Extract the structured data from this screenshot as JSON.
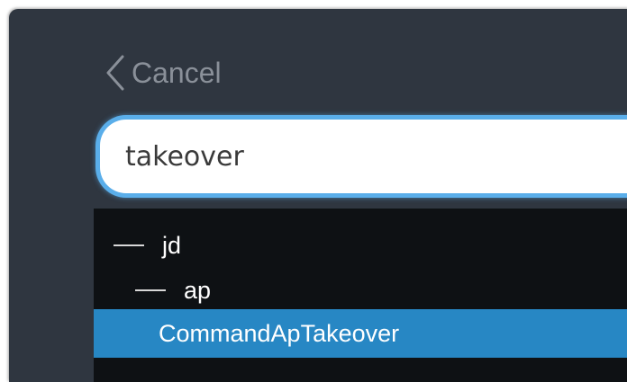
{
  "nav": {
    "cancel_label": "Cancel",
    "back_icon": "chevron-left-icon"
  },
  "search": {
    "value": "takeover"
  },
  "tree": {
    "items": [
      {
        "label": "jd",
        "level": 0,
        "selected": false
      },
      {
        "label": "ap",
        "level": 1,
        "selected": false
      },
      {
        "label": "CommandApTakeover",
        "level": 2,
        "selected": true
      }
    ]
  },
  "colors": {
    "panel_bg": "#2f3640",
    "tree_bg": "#0e1114",
    "selected_row": "#2787c4",
    "search_border": "#5aaeea",
    "cancel_text": "#8a9099"
  }
}
